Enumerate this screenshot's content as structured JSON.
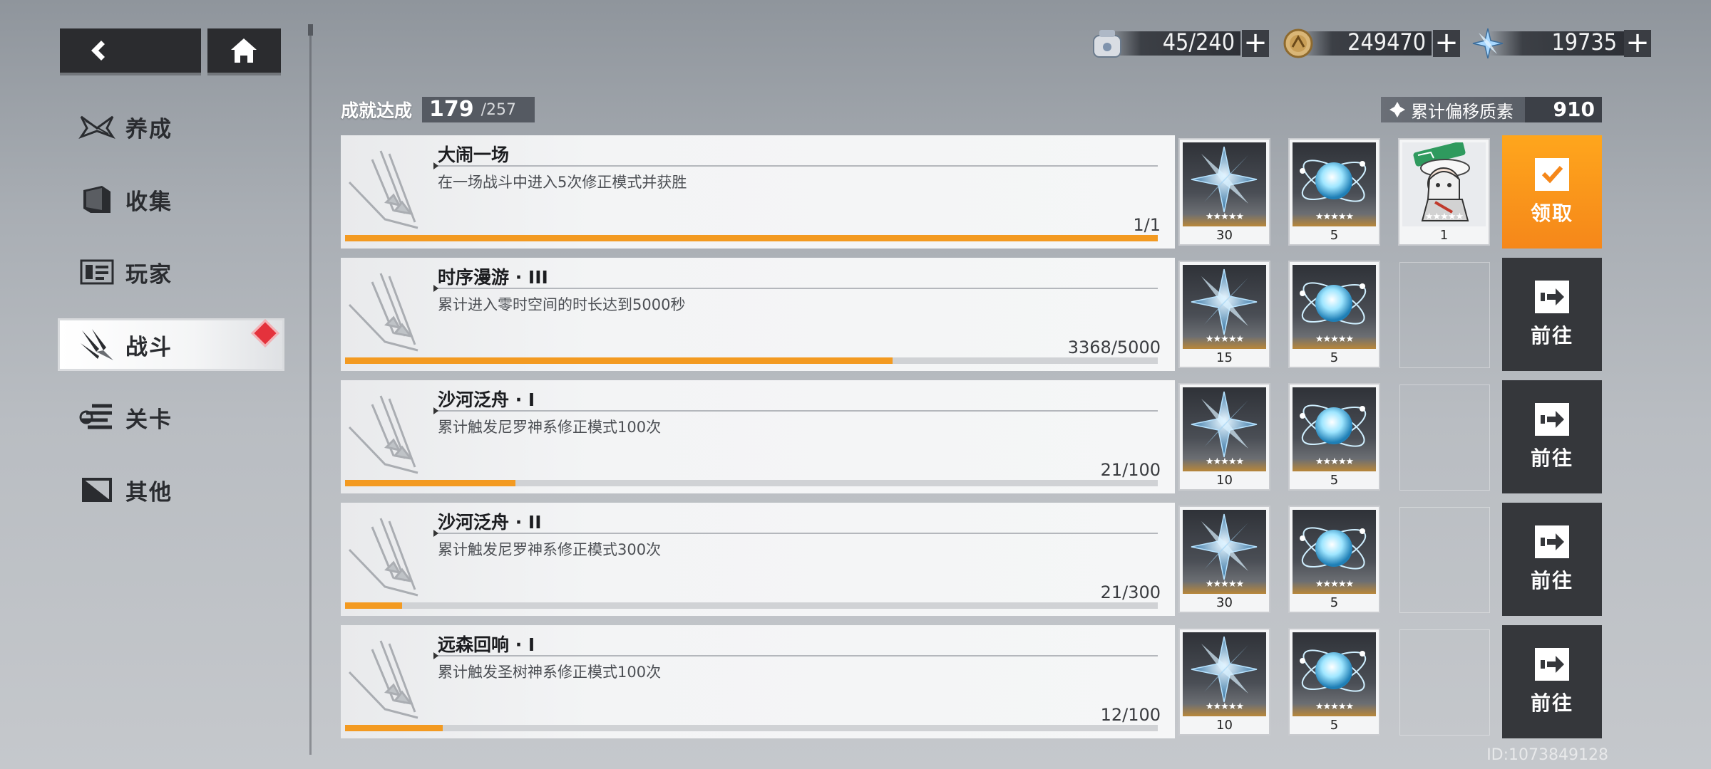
{
  "nav": {
    "back_icon": "back-arrow-icon",
    "home_icon": "home-icon"
  },
  "sidebar": {
    "items": [
      {
        "label": "养成",
        "icon": "wings-icon"
      },
      {
        "label": "收集",
        "icon": "book-icon"
      },
      {
        "label": "玩家",
        "icon": "id-card-icon"
      },
      {
        "label": "战斗",
        "icon": "blades-icon",
        "active": true,
        "badge": true
      },
      {
        "label": "关卡",
        "icon": "stage-icon"
      },
      {
        "label": "其他",
        "icon": "misc-icon"
      }
    ]
  },
  "currencies": [
    {
      "value": "45/240",
      "icon": "stamina-icon"
    },
    {
      "value": "249470",
      "icon": "coin-icon"
    },
    {
      "value": "19735",
      "icon": "crystal-icon"
    }
  ],
  "achievement": {
    "label": "成就达成",
    "achieved": "179",
    "total": "/257"
  },
  "points": {
    "label": "累计偏移质素",
    "value": "910"
  },
  "rows": [
    {
      "title": "大闹一场",
      "desc": "在一场战斗中进入5次修正模式并获胜",
      "progress": "1/1",
      "ratio": 1.0,
      "rewards": [
        {
          "type": "crystal",
          "qty": "30"
        },
        {
          "type": "orb",
          "qty": "5"
        },
        {
          "type": "character",
          "qty": "1"
        }
      ],
      "action": {
        "label": "领取",
        "kind": "claim"
      }
    },
    {
      "title": "时序漫游 · III",
      "desc": "累计进入零时空间的时长达到5000秒",
      "progress": "3368/5000",
      "ratio": 0.6736,
      "rewards": [
        {
          "type": "crystal",
          "qty": "15"
        },
        {
          "type": "orb",
          "qty": "5"
        }
      ],
      "action": {
        "label": "前往",
        "kind": "go"
      }
    },
    {
      "title": "沙河泛舟 · I",
      "desc": "累计触发尼罗神系修正模式100次",
      "progress": "21/100",
      "ratio": 0.21,
      "rewards": [
        {
          "type": "crystal",
          "qty": "10"
        },
        {
          "type": "orb",
          "qty": "5"
        }
      ],
      "action": {
        "label": "前往",
        "kind": "go"
      }
    },
    {
      "title": "沙河泛舟 · II",
      "desc": "累计触发尼罗神系修正模式300次",
      "progress": "21/300",
      "ratio": 0.07,
      "rewards": [
        {
          "type": "crystal",
          "qty": "30"
        },
        {
          "type": "orb",
          "qty": "5"
        }
      ],
      "action": {
        "label": "前往",
        "kind": "go"
      }
    },
    {
      "title": "远森回响 · I",
      "desc": "累计触发圣树神系修正模式100次",
      "progress": "12/100",
      "ratio": 0.12,
      "rewards": [
        {
          "type": "crystal",
          "qty": "10"
        },
        {
          "type": "orb",
          "qty": "5"
        }
      ],
      "action": {
        "label": "前往",
        "kind": "go"
      }
    }
  ],
  "uid": "ID:1073849128",
  "colors": {
    "accent": "#f39a21",
    "claim": "#f8901b",
    "go": "#35373b",
    "badge": "#e4323c"
  }
}
